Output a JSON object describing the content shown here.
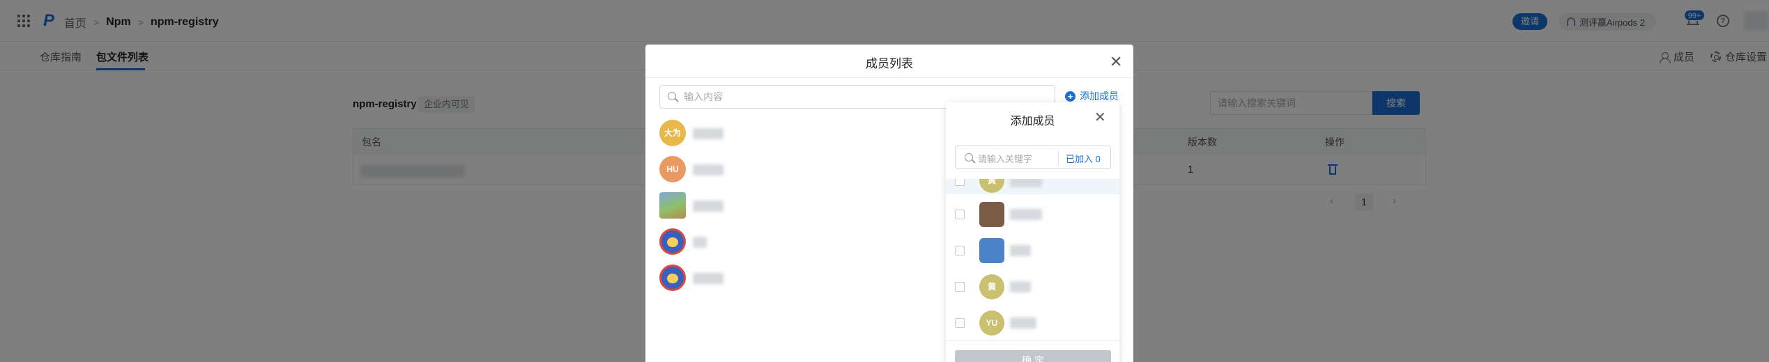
{
  "header": {
    "logo": "P",
    "breadcrumb": [
      "首页",
      "Npm",
      "npm-registry"
    ],
    "invite_label": "邀请",
    "promo_label": "测评赢Airpods 2",
    "notification_badge": "99+",
    "help_glyph": "?"
  },
  "subnav": {
    "tabs": [
      {
        "label": "仓库指南",
        "active": false
      },
      {
        "label": "包文件列表",
        "active": true
      }
    ],
    "members_label": "成员",
    "settings_label": "仓库设置"
  },
  "content": {
    "repo_name": "npm-registry",
    "repo_visibility": "企业内可见",
    "search_placeholder": "请输入搜索关键词",
    "search_button": "搜索",
    "table": {
      "columns": [
        "包名",
        "版本数",
        "操作"
      ],
      "rows": [
        {
          "versions": "1"
        }
      ]
    },
    "pagination": {
      "prev": "‹",
      "current": "1",
      "next": "›"
    }
  },
  "member_modal": {
    "title": "成员列表",
    "close_glyph": "✕",
    "search_placeholder": "输入内容",
    "add_member_label": "添加成员",
    "members": [
      {
        "avatar_text": "大为",
        "avatar_style": "yellow"
      },
      {
        "avatar_text": "HU",
        "avatar_style": "orange"
      },
      {
        "avatar_text": "",
        "avatar_style": "photo"
      },
      {
        "avatar_text": "",
        "avatar_style": "toy"
      },
      {
        "avatar_text": "",
        "avatar_style": "toy"
      }
    ]
  },
  "add_member_modal": {
    "title": "添加成员",
    "close_glyph": "✕",
    "search_placeholder": "请输入关键字",
    "joined_label": "已加入 0",
    "candidates": [
      {
        "avatar_text": "黄",
        "avatar_style": "olive"
      },
      {
        "avatar_text": "",
        "avatar_style": "brown"
      },
      {
        "avatar_text": "",
        "avatar_style": "blue"
      },
      {
        "avatar_text": "黄",
        "avatar_style": "olive"
      },
      {
        "avatar_text": "YU",
        "avatar_style": "olive"
      }
    ],
    "confirm_label": "确 定"
  },
  "colors": {
    "accent": "#1a6fd6",
    "mask": "rgba(0,0,0,0.5)",
    "disabled_button": "#c2c7cd"
  }
}
